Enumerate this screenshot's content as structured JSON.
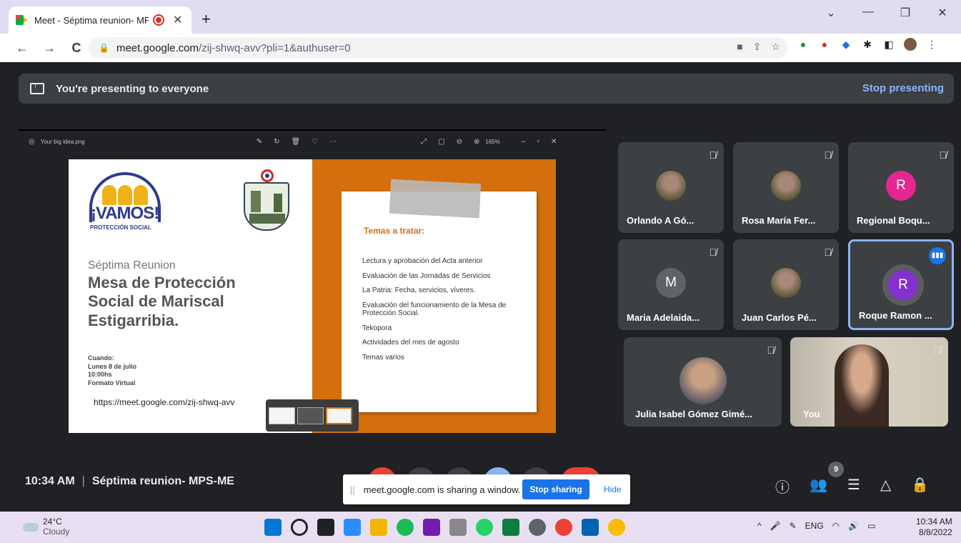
{
  "browser": {
    "tab_title": "Meet - Séptima reunion- MPS-ME",
    "new_tab": "+",
    "tab_close": "✕",
    "window_controls": [
      "⌄",
      "—",
      "❐",
      "✕"
    ],
    "nav": {
      "back": "←",
      "forward": "→",
      "reload": "C"
    },
    "url_host": "meet.google.com",
    "url_path": "/zij-shwq-avv?pli=1&authuser=0"
  },
  "presenting_bar": {
    "text": "You're presenting to everyone",
    "stop_label": "Stop presenting"
  },
  "viewer": {
    "filename": "Your big idea.png",
    "zoom": "165%"
  },
  "slide": {
    "logo_text": "¡VAMOS!",
    "logo_sub": "PROTECCIÓN SOCIAL",
    "subtitle": "Séptima Reunion",
    "title": "Mesa de Protección Social de Mariscal Estigarribia.",
    "when_label": "Cuando:",
    "when_date": "Lunes 8 de julio",
    "when_time": "10:00hs",
    "when_format": "Formato Virtual",
    "link": "https://meet.google.com/zij-shwq-avv",
    "topics_title": "Temas a tratar:",
    "topics": [
      "Lectura y aprobación del Acta anterior",
      "Evaluación de las Jornadas de Servicios",
      "La Patria: Fecha, servicios, víveres.",
      "Evaluación del funcionamiento de la Mesa de Protección Social.",
      "Tekopora",
      "Actividades del mes de agosto",
      "Temas varios"
    ]
  },
  "participants": [
    {
      "name": "Orlando A Gó...",
      "avatar": "",
      "color": ""
    },
    {
      "name": "Rosa María Fer...",
      "avatar": "",
      "color": ""
    },
    {
      "name": "Regional Boqu...",
      "avatar": "R",
      "color": "#e52592"
    },
    {
      "name": "Maria Adelaida...",
      "avatar": "M",
      "color": "#5f6368"
    },
    {
      "name": "Juan Carlos Pé...",
      "avatar": "",
      "color": ""
    },
    {
      "name": "Roque Ramon ...",
      "avatar": "R",
      "color": "#8430ce"
    },
    {
      "name": "Julia Isabel Gómez Gimé...",
      "avatar": "",
      "color": ""
    },
    {
      "name": "You",
      "avatar": "",
      "color": ""
    }
  ],
  "meeting": {
    "time": "10:34 AM",
    "separator": "|",
    "name": "Séptima reunion- MPS-ME",
    "participant_count": "9"
  },
  "share_banner": {
    "grip": "||",
    "text": "meet.google.com is sharing a window.",
    "stop_label": "Stop sharing",
    "hide_label": "Hide"
  },
  "taskbar": {
    "temp": "24°C",
    "condition": "Cloudy",
    "lang": "ENG",
    "time": "10:34 AM",
    "date": "8/8/2022"
  }
}
